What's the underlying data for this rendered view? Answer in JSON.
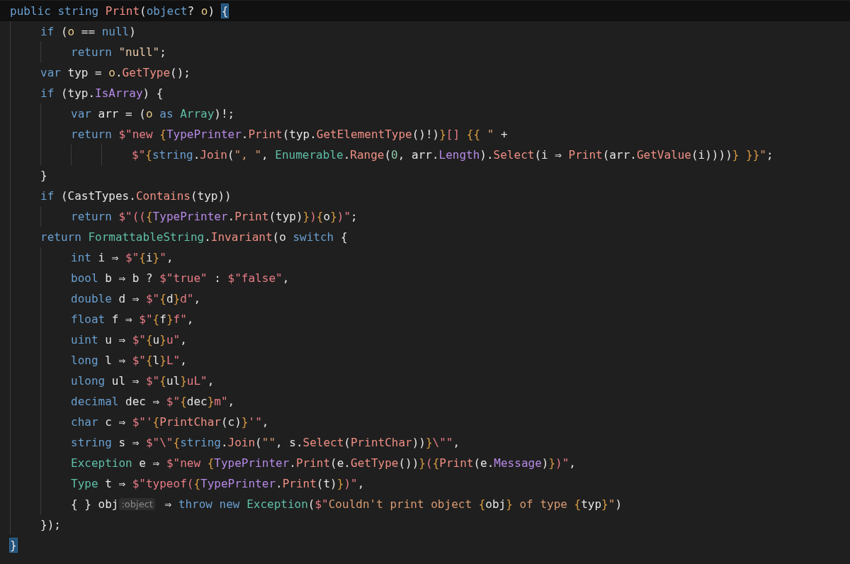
{
  "editor": {
    "lines": [
      {
        "current": true,
        "tokens": [
          {
            "kind": "kw",
            "text": "public string "
          },
          {
            "kind": "fn",
            "text": "Print"
          },
          {
            "kind": "var",
            "text": "("
          },
          {
            "kind": "kw",
            "text": "object"
          },
          {
            "kind": "var",
            "text": "? "
          },
          {
            "kind": "param",
            "text": "o"
          },
          {
            "kind": "var",
            "text": ") "
          },
          {
            "kind": "match",
            "text": "{"
          }
        ]
      },
      {
        "current": false,
        "tokens": [
          {
            "kind": "kw",
            "text": "    if "
          },
          {
            "kind": "var",
            "text": "("
          },
          {
            "kind": "param",
            "text": "o"
          },
          {
            "kind": "var",
            "text": " == "
          },
          {
            "kind": "kw",
            "text": "null"
          },
          {
            "kind": "var",
            "text": ")"
          }
        ]
      },
      {
        "current": false,
        "tokens": [
          {
            "kind": "kw",
            "text": "        return "
          },
          {
            "kind": "str",
            "text": "\"null\""
          },
          {
            "kind": "var",
            "text": ";"
          }
        ]
      },
      {
        "current": false,
        "tokens": [
          {
            "kind": "kw",
            "text": "    var "
          },
          {
            "kind": "var",
            "text": "typ = "
          },
          {
            "kind": "param",
            "text": "o"
          },
          {
            "kind": "var",
            "text": "."
          },
          {
            "kind": "fn",
            "text": "GetType"
          },
          {
            "kind": "var",
            "text": "();"
          }
        ]
      },
      {
        "current": false,
        "tokens": [
          {
            "kind": "kw",
            "text": "    if "
          },
          {
            "kind": "var",
            "text": "(typ."
          },
          {
            "kind": "prop",
            "text": "IsArray"
          },
          {
            "kind": "var",
            "text": ") {"
          }
        ]
      },
      {
        "current": false,
        "tokens": [
          {
            "kind": "kw",
            "text": "        var "
          },
          {
            "kind": "var",
            "text": "arr = ("
          },
          {
            "kind": "param",
            "text": "o"
          },
          {
            "kind": "kw",
            "text": " as "
          },
          {
            "kind": "type",
            "text": "Array"
          },
          {
            "kind": "var",
            "text": ")!;"
          }
        ]
      },
      {
        "current": false,
        "tokens": [
          {
            "kind": "kw",
            "text": "        return "
          },
          {
            "kind": "istr",
            "text": "$\"new "
          },
          {
            "kind": "brace",
            "text": "{"
          },
          {
            "kind": "prop",
            "text": "TypePrinter"
          },
          {
            "kind": "var",
            "text": "."
          },
          {
            "kind": "fn",
            "text": "Print"
          },
          {
            "kind": "var",
            "text": "(typ."
          },
          {
            "kind": "fn",
            "text": "GetElementType"
          },
          {
            "kind": "var",
            "text": "()!)"
          },
          {
            "kind": "brace",
            "text": "}"
          },
          {
            "kind": "istr",
            "text": "[] "
          },
          {
            "kind": "brace",
            "text": "{{"
          },
          {
            "kind": "lit",
            "text": " \""
          },
          {
            "kind": "var",
            "text": " +"
          }
        ]
      },
      {
        "current": false,
        "tokens": [
          {
            "kind": "istr",
            "text": "                $\""
          },
          {
            "kind": "brace",
            "text": "{"
          },
          {
            "kind": "kw",
            "text": "string"
          },
          {
            "kind": "var",
            "text": "."
          },
          {
            "kind": "fn",
            "text": "Join"
          },
          {
            "kind": "var",
            "text": "("
          },
          {
            "kind": "lit",
            "text": "\", \""
          },
          {
            "kind": "var",
            "text": ", "
          },
          {
            "kind": "type",
            "text": "Enumerable"
          },
          {
            "kind": "var",
            "text": "."
          },
          {
            "kind": "fn",
            "text": "Range"
          },
          {
            "kind": "var",
            "text": "("
          },
          {
            "kind": "num",
            "text": "0"
          },
          {
            "kind": "var",
            "text": ", arr."
          },
          {
            "kind": "prop",
            "text": "Length"
          },
          {
            "kind": "var",
            "text": ")."
          },
          {
            "kind": "fn",
            "text": "Select"
          },
          {
            "kind": "var",
            "text": "(i ⇒ "
          },
          {
            "kind": "fn",
            "text": "Print"
          },
          {
            "kind": "var",
            "text": "(arr."
          },
          {
            "kind": "fn",
            "text": "GetValue"
          },
          {
            "kind": "var",
            "text": "(i))))"
          },
          {
            "kind": "brace",
            "text": "} }}"
          },
          {
            "kind": "lit",
            "text": "\""
          },
          {
            "kind": "var",
            "text": ";"
          }
        ]
      },
      {
        "current": false,
        "tokens": [
          {
            "kind": "var",
            "text": "    }"
          }
        ]
      },
      {
        "current": false,
        "tokens": [
          {
            "kind": "kw",
            "text": "    if "
          },
          {
            "kind": "var",
            "text": "(CastTypes."
          },
          {
            "kind": "fn",
            "text": "Contains"
          },
          {
            "kind": "var",
            "text": "(typ))"
          }
        ]
      },
      {
        "current": false,
        "tokens": [
          {
            "kind": "kw",
            "text": "        return "
          },
          {
            "kind": "istr",
            "text": "$\"(("
          },
          {
            "kind": "brace",
            "text": "{"
          },
          {
            "kind": "prop",
            "text": "TypePrinter"
          },
          {
            "kind": "var",
            "text": "."
          },
          {
            "kind": "fn",
            "text": "Print"
          },
          {
            "kind": "var",
            "text": "(typ)"
          },
          {
            "kind": "brace",
            "text": "}"
          },
          {
            "kind": "istr",
            "text": ")"
          },
          {
            "kind": "brace",
            "text": "{"
          },
          {
            "kind": "var",
            "text": "o"
          },
          {
            "kind": "brace",
            "text": "}"
          },
          {
            "kind": "istr",
            "text": ")\""
          },
          {
            "kind": "var",
            "text": ";"
          }
        ]
      },
      {
        "current": false,
        "tokens": [
          {
            "kind": "kw",
            "text": "    return "
          },
          {
            "kind": "type",
            "text": "FormattableString"
          },
          {
            "kind": "var",
            "text": "."
          },
          {
            "kind": "fn",
            "text": "Invariant"
          },
          {
            "kind": "var",
            "text": "(o "
          },
          {
            "kind": "kw",
            "text": "switch"
          },
          {
            "kind": "var",
            "text": " {"
          }
        ]
      },
      {
        "current": false,
        "tokens": [
          {
            "kind": "kw",
            "text": "        int "
          },
          {
            "kind": "var",
            "text": "i ⇒ "
          },
          {
            "kind": "istr",
            "text": "$\""
          },
          {
            "kind": "brace",
            "text": "{"
          },
          {
            "kind": "var",
            "text": "i"
          },
          {
            "kind": "brace",
            "text": "}"
          },
          {
            "kind": "istr",
            "text": "\""
          },
          {
            "kind": "var",
            "text": ","
          }
        ]
      },
      {
        "current": false,
        "tokens": [
          {
            "kind": "kw",
            "text": "        bool "
          },
          {
            "kind": "var",
            "text": "b ⇒ b ? "
          },
          {
            "kind": "istr",
            "text": "$\"true\""
          },
          {
            "kind": "var",
            "text": " : "
          },
          {
            "kind": "istr",
            "text": "$\"false\""
          },
          {
            "kind": "var",
            "text": ","
          }
        ]
      },
      {
        "current": false,
        "tokens": [
          {
            "kind": "kw",
            "text": "        double "
          },
          {
            "kind": "var",
            "text": "d ⇒ "
          },
          {
            "kind": "istr",
            "text": "$\""
          },
          {
            "kind": "brace",
            "text": "{"
          },
          {
            "kind": "var",
            "text": "d"
          },
          {
            "kind": "brace",
            "text": "}"
          },
          {
            "kind": "istr",
            "text": "d\""
          },
          {
            "kind": "var",
            "text": ","
          }
        ]
      },
      {
        "current": false,
        "tokens": [
          {
            "kind": "kw",
            "text": "        float "
          },
          {
            "kind": "var",
            "text": "f ⇒ "
          },
          {
            "kind": "istr",
            "text": "$\""
          },
          {
            "kind": "brace",
            "text": "{"
          },
          {
            "kind": "var",
            "text": "f"
          },
          {
            "kind": "brace",
            "text": "}"
          },
          {
            "kind": "istr",
            "text": "f\""
          },
          {
            "kind": "var",
            "text": ","
          }
        ]
      },
      {
        "current": false,
        "tokens": [
          {
            "kind": "kw",
            "text": "        uint "
          },
          {
            "kind": "var",
            "text": "u ⇒ "
          },
          {
            "kind": "istr",
            "text": "$\""
          },
          {
            "kind": "brace",
            "text": "{"
          },
          {
            "kind": "var",
            "text": "u"
          },
          {
            "kind": "brace",
            "text": "}"
          },
          {
            "kind": "istr",
            "text": "u\""
          },
          {
            "kind": "var",
            "text": ","
          }
        ]
      },
      {
        "current": false,
        "tokens": [
          {
            "kind": "kw",
            "text": "        long "
          },
          {
            "kind": "var",
            "text": "l ⇒ "
          },
          {
            "kind": "istr",
            "text": "$\""
          },
          {
            "kind": "brace",
            "text": "{"
          },
          {
            "kind": "var",
            "text": "l"
          },
          {
            "kind": "brace",
            "text": "}"
          },
          {
            "kind": "istr",
            "text": "L\""
          },
          {
            "kind": "var",
            "text": ","
          }
        ]
      },
      {
        "current": false,
        "tokens": [
          {
            "kind": "kw",
            "text": "        ulong "
          },
          {
            "kind": "var",
            "text": "ul ⇒ "
          },
          {
            "kind": "istr",
            "text": "$\""
          },
          {
            "kind": "brace",
            "text": "{"
          },
          {
            "kind": "var",
            "text": "ul"
          },
          {
            "kind": "brace",
            "text": "}"
          },
          {
            "kind": "istr",
            "text": "uL\""
          },
          {
            "kind": "var",
            "text": ","
          }
        ]
      },
      {
        "current": false,
        "tokens": [
          {
            "kind": "kw",
            "text": "        decimal "
          },
          {
            "kind": "var",
            "text": "dec ⇒ "
          },
          {
            "kind": "istr",
            "text": "$\""
          },
          {
            "kind": "brace",
            "text": "{"
          },
          {
            "kind": "var",
            "text": "dec"
          },
          {
            "kind": "brace",
            "text": "}"
          },
          {
            "kind": "istr",
            "text": "m\""
          },
          {
            "kind": "var",
            "text": ","
          }
        ]
      },
      {
        "current": false,
        "tokens": [
          {
            "kind": "kw",
            "text": "        char "
          },
          {
            "kind": "var",
            "text": "c ⇒ "
          },
          {
            "kind": "istr",
            "text": "$\"'"
          },
          {
            "kind": "brace",
            "text": "{"
          },
          {
            "kind": "fn",
            "text": "PrintChar"
          },
          {
            "kind": "var",
            "text": "(c)"
          },
          {
            "kind": "brace",
            "text": "}"
          },
          {
            "kind": "istr",
            "text": "'\""
          },
          {
            "kind": "var",
            "text": ","
          }
        ]
      },
      {
        "current": false,
        "tokens": [
          {
            "kind": "kw",
            "text": "        string "
          },
          {
            "kind": "var",
            "text": "s ⇒ "
          },
          {
            "kind": "istr",
            "text": "$\"\\\""
          },
          {
            "kind": "brace",
            "text": "{"
          },
          {
            "kind": "kw",
            "text": "string"
          },
          {
            "kind": "var",
            "text": "."
          },
          {
            "kind": "fn",
            "text": "Join"
          },
          {
            "kind": "var",
            "text": "("
          },
          {
            "kind": "lit",
            "text": "\"\""
          },
          {
            "kind": "var",
            "text": ", s."
          },
          {
            "kind": "fn",
            "text": "Select"
          },
          {
            "kind": "var",
            "text": "("
          },
          {
            "kind": "fn",
            "text": "PrintChar"
          },
          {
            "kind": "var",
            "text": "))"
          },
          {
            "kind": "brace",
            "text": "}"
          },
          {
            "kind": "istr",
            "text": "\\\"\""
          },
          {
            "kind": "var",
            "text": ","
          }
        ]
      },
      {
        "current": false,
        "tokens": [
          {
            "kind": "type",
            "text": "        Exception"
          },
          {
            "kind": "var",
            "text": " e ⇒ "
          },
          {
            "kind": "istr",
            "text": "$\"new "
          },
          {
            "kind": "brace",
            "text": "{"
          },
          {
            "kind": "prop",
            "text": "TypePrinter"
          },
          {
            "kind": "var",
            "text": "."
          },
          {
            "kind": "fn",
            "text": "Print"
          },
          {
            "kind": "var",
            "text": "(e."
          },
          {
            "kind": "fn",
            "text": "GetType"
          },
          {
            "kind": "var",
            "text": "())"
          },
          {
            "kind": "brace",
            "text": "}"
          },
          {
            "kind": "istr",
            "text": "("
          },
          {
            "kind": "brace",
            "text": "{"
          },
          {
            "kind": "fn",
            "text": "Print"
          },
          {
            "kind": "var",
            "text": "(e."
          },
          {
            "kind": "prop",
            "text": "Message"
          },
          {
            "kind": "var",
            "text": ")"
          },
          {
            "kind": "brace",
            "text": "}"
          },
          {
            "kind": "istr",
            "text": ")\""
          },
          {
            "kind": "var",
            "text": ","
          }
        ]
      },
      {
        "current": false,
        "tokens": [
          {
            "kind": "type",
            "text": "        Type"
          },
          {
            "kind": "var",
            "text": " t ⇒ "
          },
          {
            "kind": "istr",
            "text": "$\"typeof("
          },
          {
            "kind": "brace",
            "text": "{"
          },
          {
            "kind": "prop",
            "text": "TypePrinter"
          },
          {
            "kind": "var",
            "text": "."
          },
          {
            "kind": "fn",
            "text": "Print"
          },
          {
            "kind": "var",
            "text": "(t)"
          },
          {
            "kind": "brace",
            "text": "}"
          },
          {
            "kind": "istr",
            "text": ")\""
          },
          {
            "kind": "var",
            "text": ","
          }
        ]
      },
      {
        "current": false,
        "tokens": [
          {
            "kind": "var",
            "text": "        { } obj"
          },
          {
            "kind": "hint",
            "text": ":object"
          },
          {
            "kind": "var",
            "text": " ⇒ "
          },
          {
            "kind": "kw",
            "text": "throw new "
          },
          {
            "kind": "type",
            "text": "Exception"
          },
          {
            "kind": "var",
            "text": "("
          },
          {
            "kind": "istr",
            "text": "$\""
          },
          {
            "kind": "lit",
            "text": "Couldn't print object "
          },
          {
            "kind": "brace",
            "text": "{"
          },
          {
            "kind": "var",
            "text": "obj"
          },
          {
            "kind": "brace",
            "text": "}"
          },
          {
            "kind": "lit",
            "text": " of type "
          },
          {
            "kind": "brace",
            "text": "{"
          },
          {
            "kind": "var",
            "text": "typ"
          },
          {
            "kind": "brace",
            "text": "}"
          },
          {
            "kind": "lit",
            "text": "\""
          },
          {
            "kind": "var",
            "text": ")"
          }
        ]
      },
      {
        "current": false,
        "tokens": [
          {
            "kind": "var",
            "text": "    });"
          }
        ]
      },
      {
        "current": false,
        "tokens": [
          {
            "kind": "match",
            "text": "}"
          }
        ]
      }
    ]
  }
}
